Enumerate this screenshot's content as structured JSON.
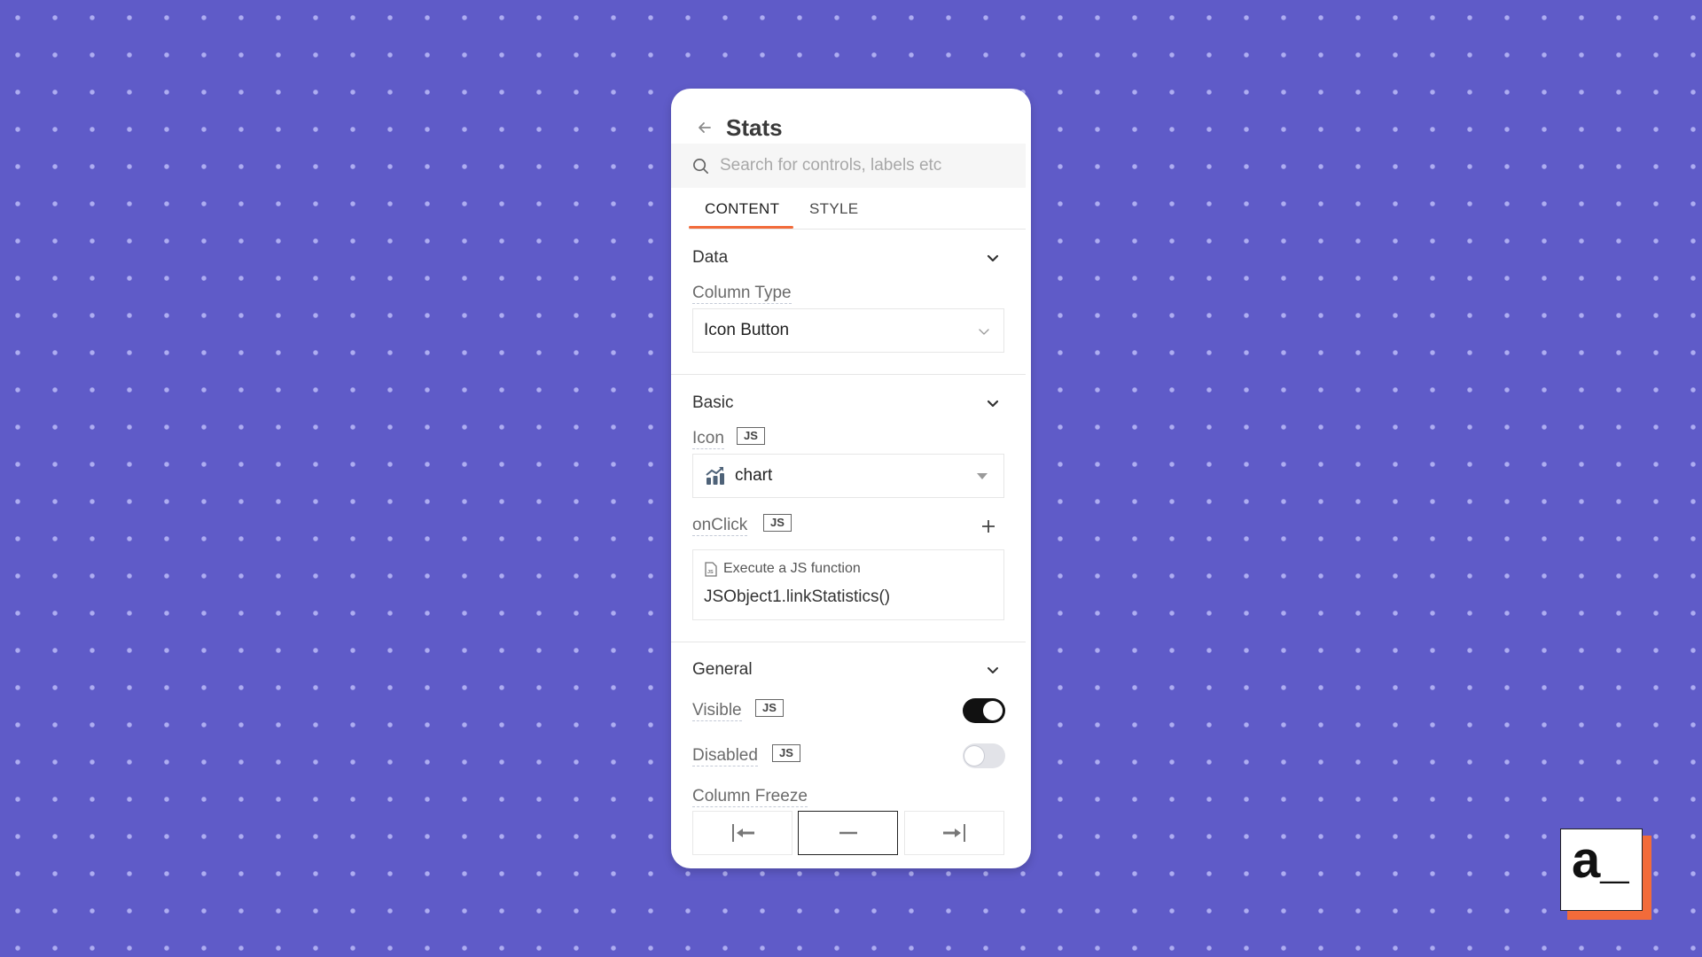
{
  "panel": {
    "title": "Stats",
    "search_placeholder": "Search for controls, labels etc",
    "tabs": [
      {
        "label": "CONTENT",
        "active": true
      },
      {
        "label": "STYLE",
        "active": false
      }
    ]
  },
  "sections": {
    "data": {
      "title": "Data",
      "column_type_label": "Column Type",
      "column_type_value": "Icon Button"
    },
    "basic": {
      "title": "Basic",
      "icon_label": "Icon",
      "icon_value": "chart",
      "onclick_label": "onClick",
      "action_type": "Execute a JS function",
      "action_value": "JSObject1.linkStatistics()"
    },
    "general": {
      "title": "General",
      "visible_label": "Visible",
      "visible_on": true,
      "disabled_label": "Disabled",
      "disabled_on": false,
      "column_freeze_label": "Column Freeze",
      "column_freeze_options": [
        "left",
        "none",
        "right"
      ],
      "column_freeze_selected": "none"
    }
  },
  "js_badge": "JS",
  "logo_text": "a_",
  "colors": {
    "background": "#5f5bc8",
    "accent": "#f26b3a",
    "toggle_on": "#111111",
    "toggle_off": "#e2e3e8"
  }
}
